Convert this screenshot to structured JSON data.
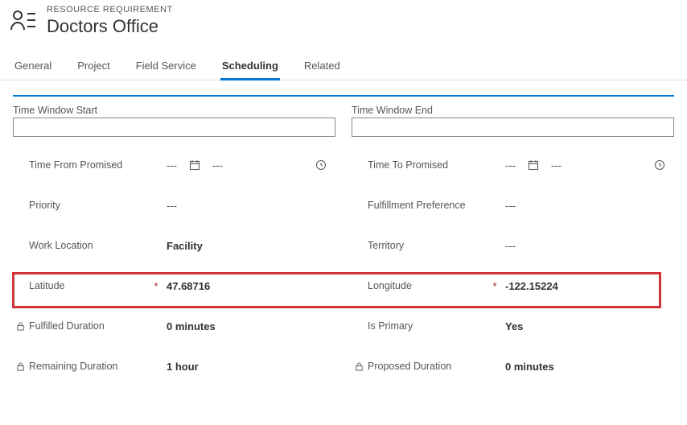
{
  "header": {
    "eyebrow": "RESOURCE REQUIREMENT",
    "title": "Doctors Office"
  },
  "tabs": {
    "general": "General",
    "project": "Project",
    "field_service": "Field Service",
    "scheduling": "Scheduling",
    "related": "Related"
  },
  "left": {
    "section_label": "Time Window Start",
    "section_value": "",
    "time_from_promised": {
      "label": "Time From Promised",
      "value1": "---",
      "value2": "---"
    },
    "priority": {
      "label": "Priority",
      "value": "---"
    },
    "work_location": {
      "label": "Work Location",
      "value": "Facility"
    },
    "latitude": {
      "label": "Latitude",
      "value": "47.68716"
    },
    "fulfilled_duration": {
      "label": "Fulfilled Duration",
      "value": "0 minutes"
    },
    "remaining_duration": {
      "label": "Remaining Duration",
      "value": "1 hour"
    }
  },
  "right": {
    "section_label": "Time Window End",
    "section_value": "",
    "time_to_promised": {
      "label": "Time To Promised",
      "value1": "---",
      "value2": "---"
    },
    "fulfillment_pref": {
      "label": "Fulfillment Preference",
      "value": "---"
    },
    "territory": {
      "label": "Territory",
      "value": "---"
    },
    "longitude": {
      "label": "Longitude",
      "value": "-122.15224"
    },
    "is_primary": {
      "label": "Is Primary",
      "value": "Yes"
    },
    "proposed_duration": {
      "label": "Proposed Duration",
      "value": "0 minutes"
    }
  }
}
